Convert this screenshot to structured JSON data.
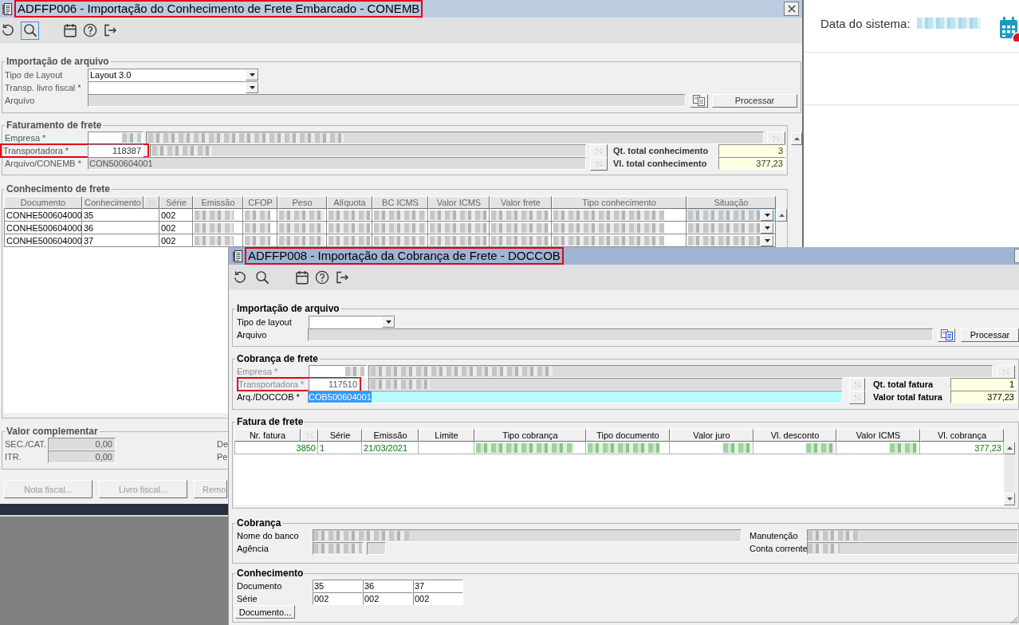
{
  "conemb_window": {
    "title": "ADFFP006 - Importação do Conhecimento de Frete Embarcado - CONEMB",
    "title_highlighted": true,
    "search_focused": true,
    "file_import": {
      "title": "Importação de arquivo",
      "layout": {
        "label": "Tipo de Layout",
        "value": "Layout 3.0"
      },
      "carrier_book": {
        "label": "Transp. livro fiscal *"
      },
      "file": {
        "label": "Arquivo"
      },
      "process_button": "Processar"
    },
    "billing": {
      "title": "Faturamento de frete",
      "company": {
        "label": "Empresa *",
        "redacted": true
      },
      "carrier": {
        "label": "Transportadora *",
        "code": "118387",
        "redacted": true,
        "highlighted": true
      },
      "file": {
        "label": "Arquivo/CONEMB *",
        "value": "CON500604001"
      },
      "totals": [
        {
          "label": "Qt. total conhecimento",
          "value": "3"
        },
        {
          "label": "Vl. total conhecimento",
          "value": "377,23"
        }
      ]
    },
    "documents": {
      "title": "Conhecimento de frete",
      "columns": [
        {
          "kind": "text",
          "label": "Documento"
        },
        {
          "kind": "text",
          "label": "Conhecimento",
          "lookup": true
        },
        {
          "kind": "text",
          "label": "Série"
        },
        {
          "kind": "text",
          "label": "Emissão"
        },
        {
          "kind": "text",
          "label": "CFOP"
        },
        {
          "kind": "number",
          "label": "Peso"
        },
        {
          "kind": "number",
          "label": "Alíquota"
        },
        {
          "kind": "number",
          "label": "BC ICMS"
        },
        {
          "kind": "number",
          "label": "Valor ICMS"
        },
        {
          "kind": "number",
          "label": "Valor frete"
        },
        {
          "kind": "text",
          "label": "Tipo conhecimento"
        },
        {
          "kind": "combo",
          "label": "Situação"
        }
      ],
      "rows": [
        {
          "selected": true,
          "cells": [
            {
              "kind": "text",
              "text": "CONHE500604000"
            },
            {
              "kind": "text",
              "text": "35"
            },
            {
              "kind": "text",
              "text": "002"
            },
            {
              "kind": "blurred"
            },
            {
              "kind": "blurred"
            },
            {
              "kind": "blurred"
            },
            {
              "kind": "blurred"
            },
            {
              "kind": "blurred"
            },
            {
              "kind": "blurred"
            },
            {
              "kind": "blurred"
            },
            {
              "kind": "blurred"
            },
            {
              "kind": "blurred"
            }
          ]
        },
        {
          "selected": false,
          "cells": [
            {
              "kind": "text",
              "text": "CONHE500604000"
            },
            {
              "kind": "text",
              "text": "36"
            },
            {
              "kind": "text",
              "text": "002"
            },
            {
              "kind": "blurred"
            },
            {
              "kind": "blurred"
            },
            {
              "kind": "blurred"
            },
            {
              "kind": "blurred"
            },
            {
              "kind": "blurred"
            },
            {
              "kind": "blurred"
            },
            {
              "kind": "blurred"
            },
            {
              "kind": "blurred"
            },
            {
              "kind": "blurred"
            }
          ]
        },
        {
          "selected": false,
          "cells": [
            {
              "kind": "text",
              "text": "CONHE500604000"
            },
            {
              "kind": "text",
              "text": "37"
            },
            {
              "kind": "text",
              "text": "002"
            },
            {
              "kind": "blurred"
            },
            {
              "kind": "blurred"
            },
            {
              "kind": "blurred"
            },
            {
              "kind": "blurred"
            },
            {
              "kind": "blurred"
            },
            {
              "kind": "blurred"
            },
            {
              "kind": "blurred"
            },
            {
              "kind": "blurred"
            },
            {
              "kind": "blurred"
            }
          ]
        }
      ]
    },
    "complement": {
      "title": "Valor complementar",
      "fields": [
        {
          "label": "SEC./CAT.",
          "value": "0,00"
        },
        {
          "label": "ITR.",
          "value": "0,00"
        }
      ],
      "side_labels": [
        "De",
        "Pe"
      ]
    },
    "buttons": [
      {
        "label": "Nota fiscal...",
        "disabled": true
      },
      {
        "label": "Livro fiscal...",
        "disabled": true
      },
      {
        "label": "Remo",
        "disabled": true
      }
    ]
  },
  "side_panel": {
    "label": "Data do sistema:",
    "value_redacted": true
  },
  "doccob_window": {
    "title": "ADFFP008 - Importação da Cobrança de Frete - DOCCOB",
    "title_highlighted": true,
    "file_import": {
      "title": "Importação de arquivo",
      "layout": {
        "label": "Tipo de layout"
      },
      "file": {
        "label": "Arquivo"
      },
      "process_button": "Processar"
    },
    "billing": {
      "title": "Cobrança de frete",
      "company": {
        "label": "Empresa *",
        "redacted": true,
        "disabled": true
      },
      "carrier": {
        "label": "Transportadora *",
        "code": "117510",
        "redacted": true,
        "highlighted": true,
        "disabled": true
      },
      "file": {
        "label": "Arq./DOCCOB *",
        "value": "COB500604001",
        "text_selected": true
      },
      "totals": [
        {
          "label": "Qt. total fatura",
          "value": "1"
        },
        {
          "label": "Valor total fatura",
          "value": "377,23"
        }
      ]
    },
    "invoices": {
      "title": "Fatura de frete",
      "columns": [
        {
          "kind": "number",
          "label": "Nr. fatura",
          "lookup": true
        },
        {
          "kind": "text",
          "label": "Série"
        },
        {
          "kind": "text",
          "label": "Emissão"
        },
        {
          "kind": "text",
          "label": "Limite"
        },
        {
          "kind": "text",
          "label": "Tipo cobrança"
        },
        {
          "kind": "text",
          "label": "Tipo documento"
        },
        {
          "kind": "number",
          "label": "Valor juro"
        },
        {
          "kind": "number",
          "label": "Vl. desconto"
        },
        {
          "kind": "number",
          "label": "Valor ICMS"
        },
        {
          "kind": "number",
          "label": "Vl. cobrança"
        }
      ],
      "rows": [
        {
          "cells": [
            {
              "kind": "text",
              "text": "3850"
            },
            {
              "kind": "text",
              "text": "1"
            },
            {
              "kind": "text",
              "text": "21/03/2021"
            },
            {
              "kind": "empty"
            },
            {
              "kind": "blurred"
            },
            {
              "kind": "blurred"
            },
            {
              "kind": "blurred"
            },
            {
              "kind": "blurred"
            },
            {
              "kind": "blurred"
            },
            {
              "kind": "text",
              "text": "377,23"
            }
          ]
        }
      ]
    },
    "bank": {
      "title": "Cobrança",
      "fields": [
        {
          "label": "Nome do banco",
          "redacted": true
        },
        {
          "label": "Agência",
          "redacted": true
        },
        {
          "label": "Manutenção",
          "redacted": true
        },
        {
          "label": "Conta corrente",
          "redacted": true
        }
      ]
    },
    "documents": {
      "title": "Conhecimento",
      "rows": [
        {
          "label": "Documento",
          "values": [
            "35",
            "36",
            "37"
          ]
        },
        {
          "label": "Série",
          "values": [
            "002",
            "002",
            "002"
          ]
        }
      ],
      "button": "Documento..."
    }
  }
}
